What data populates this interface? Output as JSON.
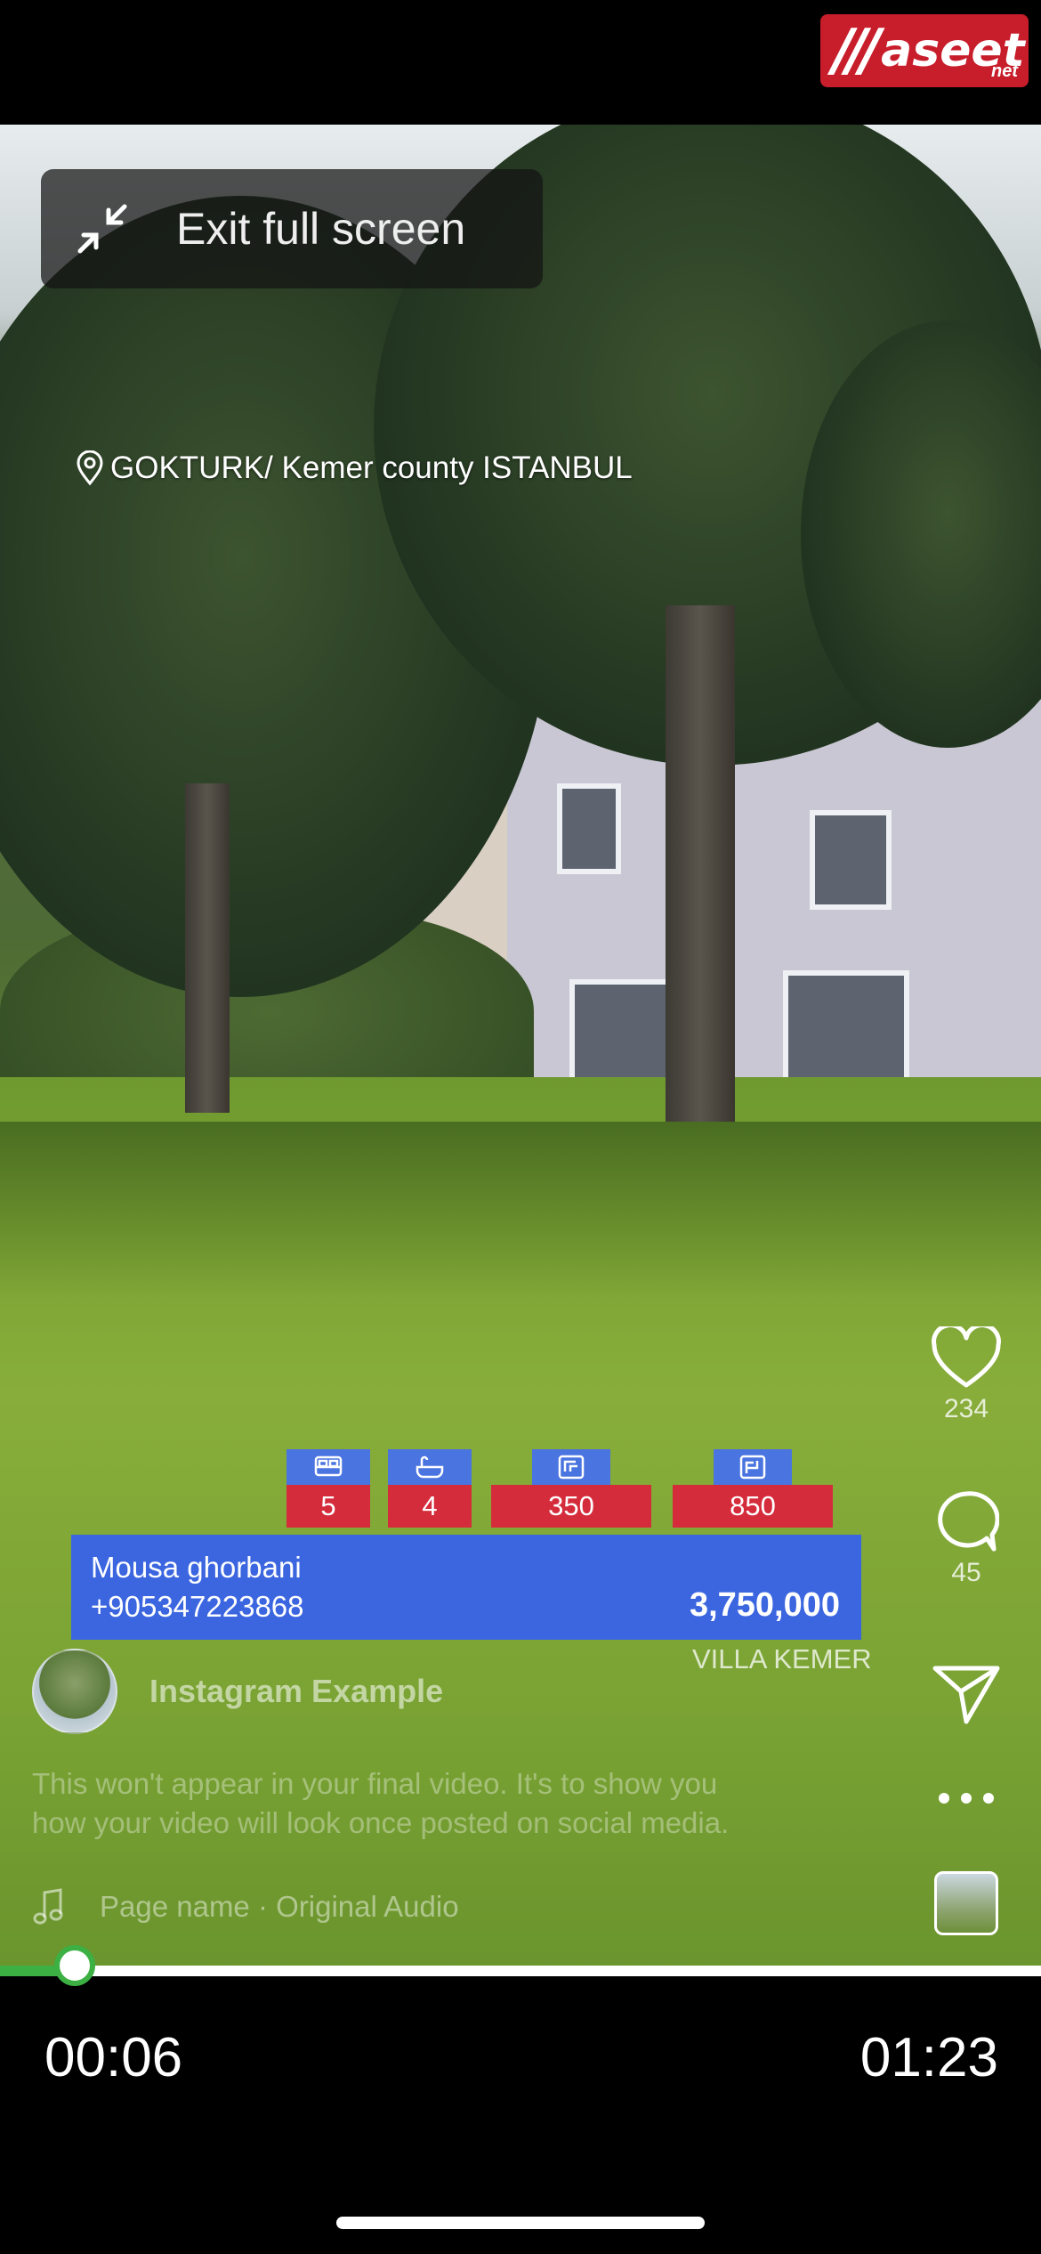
{
  "brand": {
    "logo_slashes": "///",
    "logo_text": "aseet",
    "logo_sub": "net",
    "logo_color": "#c81d2b"
  },
  "exit_fullscreen": {
    "label": "Exit full screen",
    "icon": "minimize-arrows-icon"
  },
  "location": {
    "icon": "location-pin-icon",
    "text": "GOKTURK/ Kemer county ISTANBUL"
  },
  "listing": {
    "stats": [
      {
        "icon": "bed-icon",
        "value": "5"
      },
      {
        "icon": "bathtub-icon",
        "value": "4"
      },
      {
        "icon": "floor-plan-icon",
        "value": "350"
      },
      {
        "icon": "land-area-icon",
        "value": "850"
      }
    ],
    "agent_name": "Mousa ghorbani",
    "agent_phone": "+905347223868",
    "price": "3,750,000",
    "title": "VILLA KEMER",
    "accent_blue": "#3b66e0",
    "accent_red": "#d52c3c"
  },
  "post": {
    "account_name": "Instagram Example",
    "caption": "This won't appear in your final video. It's to show you how your video will look once posted on social media.",
    "audio": "Page name · Original Audio"
  },
  "actions": {
    "likes": "234",
    "comments": "45"
  },
  "player": {
    "elapsed": "00:06",
    "duration": "01:23",
    "progress": 0.072,
    "accent": "#3cb043"
  }
}
